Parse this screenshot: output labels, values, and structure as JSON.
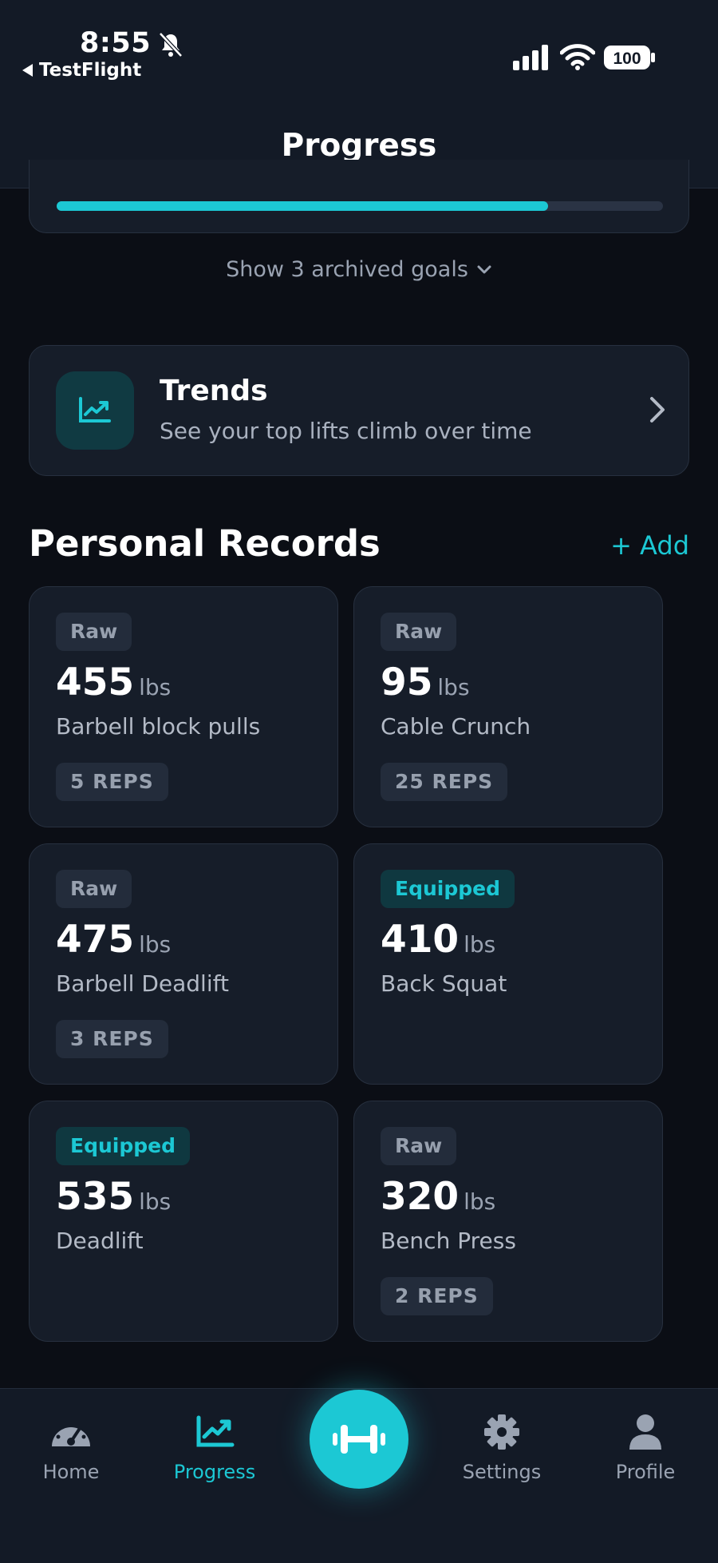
{
  "status_bar": {
    "time": "8:55",
    "back_app": "TestFlight",
    "battery": "100"
  },
  "header": {
    "title": "Progress"
  },
  "goal": {
    "progress_percent": 81
  },
  "archived": {
    "label": "Show 3 archived goals"
  },
  "trends": {
    "title": "Trends",
    "subtitle": "See your top lifts climb over time"
  },
  "personal_records": {
    "title": "Personal Records",
    "add_label": "+ Add",
    "records": [
      {
        "type": "Raw",
        "value": "455",
        "unit": "lbs",
        "name": "Barbell block pulls",
        "reps": "5 REPS"
      },
      {
        "type": "Raw",
        "value": "95",
        "unit": "lbs",
        "name": "Cable Crunch",
        "reps": "25 REPS"
      },
      {
        "type": "Raw",
        "value": "475",
        "unit": "lbs",
        "name": "Barbell Deadlift",
        "reps": "3 REPS"
      },
      {
        "type": "Equipped",
        "value": "410",
        "unit": "lbs",
        "name": "Back Squat",
        "reps": ""
      },
      {
        "type": "Equipped",
        "value": "535",
        "unit": "lbs",
        "name": "Deadlift",
        "reps": ""
      },
      {
        "type": "Raw",
        "value": "320",
        "unit": "lbs",
        "name": "Bench Press",
        "reps": "2 REPS"
      }
    ]
  },
  "tabs": [
    {
      "label": "Home",
      "icon": "gauge-icon",
      "active": false
    },
    {
      "label": "Progress",
      "icon": "trend-chart-icon",
      "active": true
    },
    {
      "label": "Settings",
      "icon": "gear-icon",
      "active": false
    },
    {
      "label": "Profile",
      "icon": "person-icon",
      "active": false
    }
  ],
  "colors": {
    "background": "#0b0e15",
    "surface": "#161d29",
    "accent": "#1cc8d4",
    "muted_text": "#9aa3b2"
  }
}
